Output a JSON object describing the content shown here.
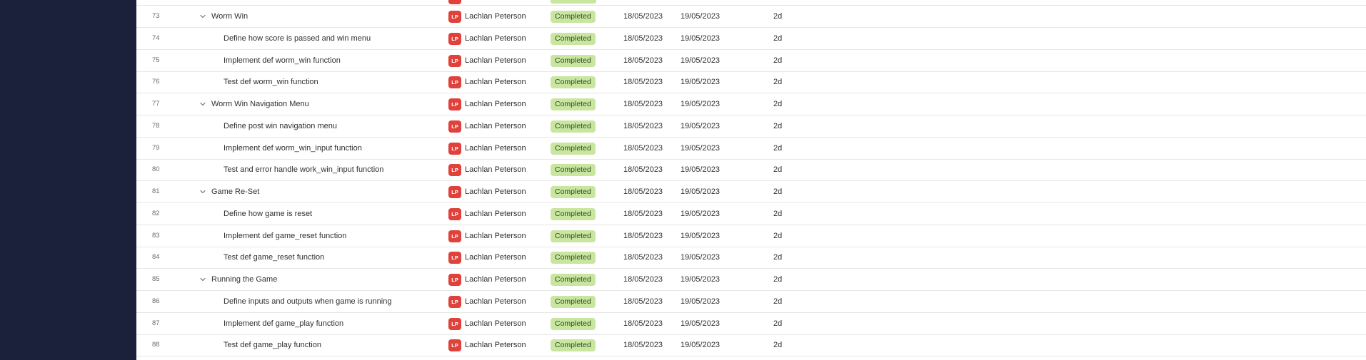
{
  "colors": {
    "sidebar_bg": "#1b213b",
    "avatar_bg": "#e0413b",
    "status_completed_bg": "#c8e6a0",
    "row_border": "#e6e6e6"
  },
  "icons": {
    "expand": "chevron-down-icon"
  },
  "rows": [
    {
      "num": "73",
      "name": "Worm Win",
      "is_parent": true,
      "initials": "LP",
      "assignee": "Lachlan Peterson",
      "status": "Completed",
      "start": "18/05/2023",
      "end": "19/05/2023",
      "duration": "2d"
    },
    {
      "num": "74",
      "name": "Define how score is passed and win menu",
      "is_parent": false,
      "initials": "LP",
      "assignee": "Lachlan Peterson",
      "status": "Completed",
      "start": "18/05/2023",
      "end": "19/05/2023",
      "duration": "2d"
    },
    {
      "num": "75",
      "name": "Implement def worm_win function",
      "is_parent": false,
      "initials": "LP",
      "assignee": "Lachlan Peterson",
      "status": "Completed",
      "start": "18/05/2023",
      "end": "19/05/2023",
      "duration": "2d"
    },
    {
      "num": "76",
      "name": "Test def worm_win function",
      "is_parent": false,
      "initials": "LP",
      "assignee": "Lachlan Peterson",
      "status": "Completed",
      "start": "18/05/2023",
      "end": "19/05/2023",
      "duration": "2d"
    },
    {
      "num": "77",
      "name": "Worm Win Navigation Menu",
      "is_parent": true,
      "initials": "LP",
      "assignee": "Lachlan Peterson",
      "status": "Completed",
      "start": "18/05/2023",
      "end": "19/05/2023",
      "duration": "2d"
    },
    {
      "num": "78",
      "name": "Define post win navigation menu",
      "is_parent": false,
      "initials": "LP",
      "assignee": "Lachlan Peterson",
      "status": "Completed",
      "start": "18/05/2023",
      "end": "19/05/2023",
      "duration": "2d"
    },
    {
      "num": "79",
      "name": "Implement def worm_win_input function",
      "is_parent": false,
      "initials": "LP",
      "assignee": "Lachlan Peterson",
      "status": "Completed",
      "start": "18/05/2023",
      "end": "19/05/2023",
      "duration": "2d"
    },
    {
      "num": "80",
      "name": "Test and error handle work_win_input function",
      "is_parent": false,
      "initials": "LP",
      "assignee": "Lachlan Peterson",
      "status": "Completed",
      "start": "18/05/2023",
      "end": "19/05/2023",
      "duration": "2d"
    },
    {
      "num": "81",
      "name": "Game Re-Set",
      "is_parent": true,
      "initials": "LP",
      "assignee": "Lachlan Peterson",
      "status": "Completed",
      "start": "18/05/2023",
      "end": "19/05/2023",
      "duration": "2d"
    },
    {
      "num": "82",
      "name": "Define how game is reset",
      "is_parent": false,
      "initials": "LP",
      "assignee": "Lachlan Peterson",
      "status": "Completed",
      "start": "18/05/2023",
      "end": "19/05/2023",
      "duration": "2d"
    },
    {
      "num": "83",
      "name": "Implement def game_reset function",
      "is_parent": false,
      "initials": "LP",
      "assignee": "Lachlan Peterson",
      "status": "Completed",
      "start": "18/05/2023",
      "end": "19/05/2023",
      "duration": "2d"
    },
    {
      "num": "84",
      "name": "Test def game_reset function",
      "is_parent": false,
      "initials": "LP",
      "assignee": "Lachlan Peterson",
      "status": "Completed",
      "start": "18/05/2023",
      "end": "19/05/2023",
      "duration": "2d"
    },
    {
      "num": "85",
      "name": "Running the Game",
      "is_parent": true,
      "initials": "LP",
      "assignee": "Lachlan Peterson",
      "status": "Completed",
      "start": "18/05/2023",
      "end": "19/05/2023",
      "duration": "2d"
    },
    {
      "num": "86",
      "name": "Define inputs and outputs when game is running",
      "is_parent": false,
      "initials": "LP",
      "assignee": "Lachlan Peterson",
      "status": "Completed",
      "start": "18/05/2023",
      "end": "19/05/2023",
      "duration": "2d"
    },
    {
      "num": "87",
      "name": "Implement def game_play function",
      "is_parent": false,
      "initials": "LP",
      "assignee": "Lachlan Peterson",
      "status": "Completed",
      "start": "18/05/2023",
      "end": "19/05/2023",
      "duration": "2d"
    },
    {
      "num": "88",
      "name": "Test def game_play function",
      "is_parent": false,
      "initials": "LP",
      "assignee": "Lachlan Peterson",
      "status": "Completed",
      "start": "18/05/2023",
      "end": "19/05/2023",
      "duration": "2d"
    }
  ]
}
